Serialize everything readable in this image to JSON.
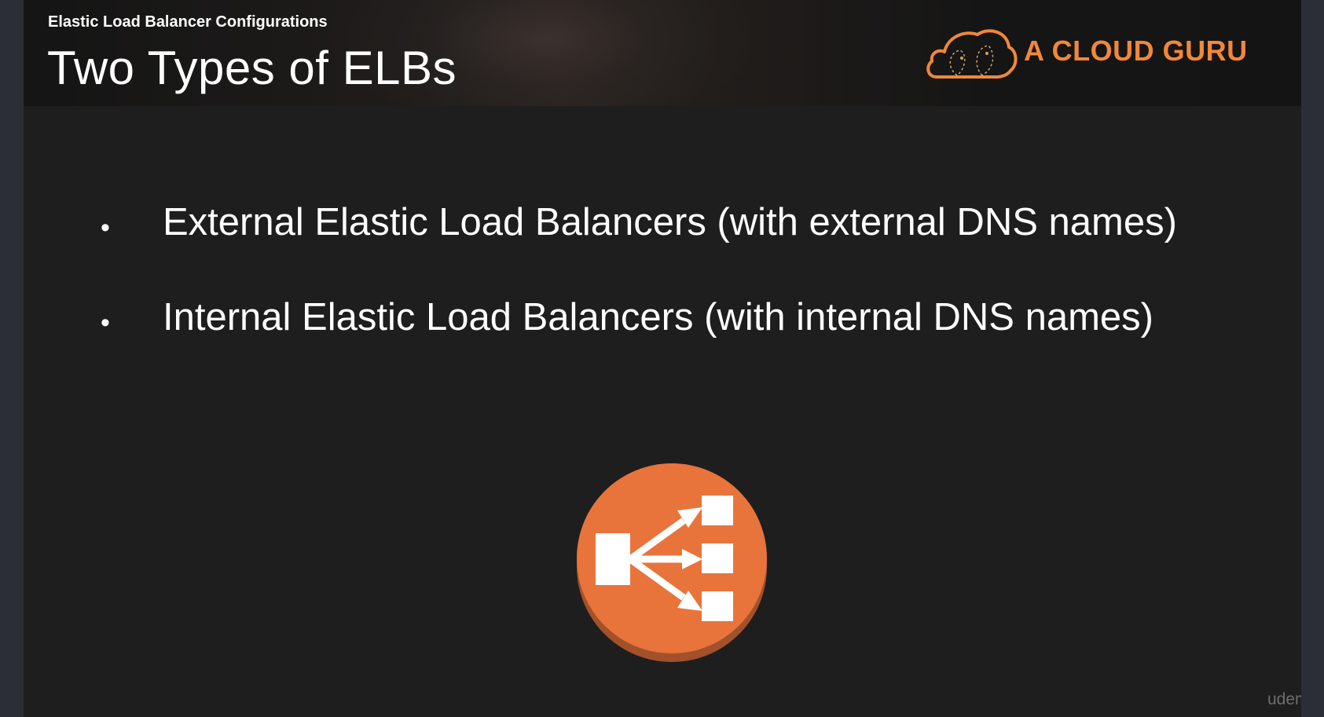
{
  "slide": {
    "section_label": "Elastic Load Balancer Configurations",
    "title": "Two Types of ELBs",
    "brand": {
      "name": "A CLOUD GURU",
      "logo_icon": "cloud-logo-icon",
      "accent_color": "#f0883a"
    },
    "bullets": [
      {
        "marker": "•",
        "text": "External Elastic Load Balancers (with external DNS names)"
      },
      {
        "marker": "•",
        "text": "Internal Elastic Load Balancers (with internal DNS names)"
      }
    ],
    "illustration": {
      "icon": "load-balancer-icon",
      "color": "#e8743b",
      "shadow_color": "#a3512a"
    },
    "watermark": "udemy"
  },
  "colors": {
    "slide_background": "#1e1e1e",
    "page_background": "#2b2e36",
    "text": "#ffffff"
  }
}
